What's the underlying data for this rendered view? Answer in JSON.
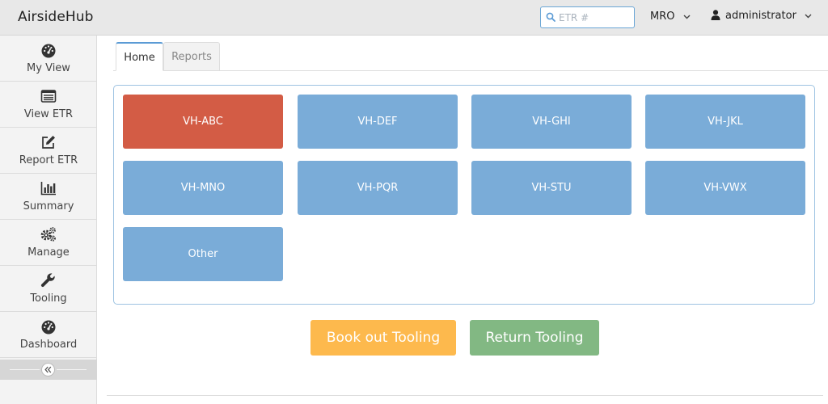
{
  "header": {
    "brand": "AirsideHub",
    "search_placeholder": "ETR #",
    "search_value": "",
    "org": "MRO",
    "user": "administrator",
    "icons": {
      "search": "search-icon",
      "org_dropdown": "chevron-down-icon",
      "user": "user-icon",
      "user_dropdown": "chevron-down-icon"
    }
  },
  "sidebar": {
    "items": [
      {
        "label": "My View",
        "icon": "dashboard-gauge-icon"
      },
      {
        "label": "View ETR",
        "icon": "list-icon"
      },
      {
        "label": "Report ETR",
        "icon": "edit-icon"
      },
      {
        "label": "Summary",
        "icon": "bar-chart-icon"
      },
      {
        "label": "Manage",
        "icon": "gears-icon"
      },
      {
        "label": "Tooling",
        "icon": "wrench-icon"
      },
      {
        "label": "Dashboard",
        "icon": "dashboard-gauge-icon"
      }
    ],
    "collapse_icon": "double-chevron-left-icon"
  },
  "tabs": [
    {
      "label": "Home",
      "active": true
    },
    {
      "label": "Reports",
      "active": false
    }
  ],
  "aircraft": [
    {
      "label": "VH-ABC",
      "status": "alert"
    },
    {
      "label": "VH-DEF",
      "status": "normal"
    },
    {
      "label": "VH-GHI",
      "status": "normal"
    },
    {
      "label": "VH-JKL",
      "status": "normal"
    },
    {
      "label": "VH-MNO",
      "status": "normal"
    },
    {
      "label": "VH-PQR",
      "status": "normal"
    },
    {
      "label": "VH-STU",
      "status": "normal"
    },
    {
      "label": "VH-VWX",
      "status": "normal"
    },
    {
      "label": "Other",
      "status": "normal"
    }
  ],
  "actions": {
    "book_out": "Book out Tooling",
    "return": "Return Tooling"
  },
  "colors": {
    "tile_normal": "#7aacd8",
    "tile_alert": "#d35c45",
    "book_out": "#fdb94d",
    "return": "#82b883",
    "accent": "#5b9bd5"
  }
}
